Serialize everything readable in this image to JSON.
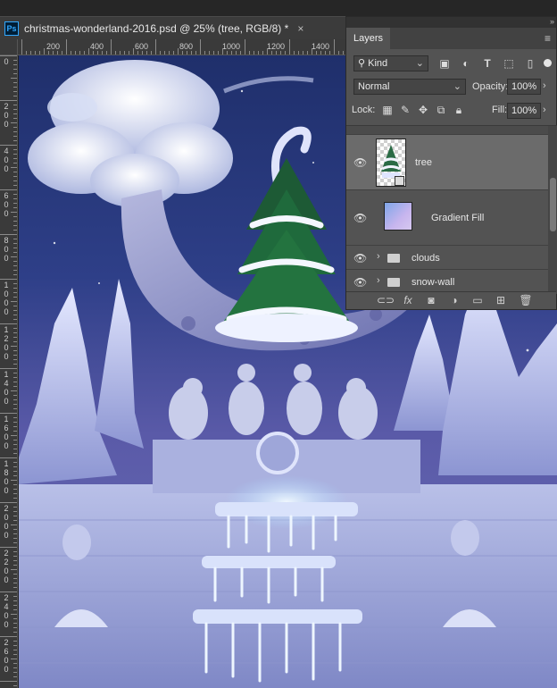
{
  "document": {
    "app_badge": "Ps",
    "tab_title": "christmas-wonderland-2016.psd @ 25% (tree, RGB/8) *",
    "close_glyph": "×"
  },
  "ruler": {
    "horizontal_labels": [
      "200",
      "400",
      "600",
      "800",
      "1000",
      "1200",
      "1400"
    ],
    "vertical_labels": [
      "0",
      "200",
      "400",
      "600",
      "800",
      "1000",
      "1200",
      "1400",
      "1600",
      "1800",
      "2000",
      "2200",
      "2400",
      "2600"
    ]
  },
  "layers_panel": {
    "tab_label": "Layers",
    "collapse_glyph": "»",
    "menu_glyph": "≡",
    "filter": {
      "value": "Kind",
      "icon": "search-icon"
    },
    "blend_mode": "Normal",
    "opacity_label": "Opacity:",
    "opacity_value": "100%",
    "lock_label": "Lock:",
    "fill_label": "Fill:",
    "fill_value": "100%",
    "layers": [
      {
        "name": "tree",
        "visible": true,
        "selected": true,
        "kind": "smart-object"
      },
      {
        "name": "Gradient Fill",
        "visible": true,
        "selected": false,
        "kind": "fill"
      },
      {
        "name": "clouds",
        "visible": true,
        "selected": false,
        "kind": "group"
      },
      {
        "name": "snow-wall",
        "visible": true,
        "selected": false,
        "kind": "group"
      }
    ],
    "footer_icons": [
      "link-icon",
      "fx-icon",
      "mask-icon",
      "adjustment-icon",
      "folder-icon",
      "new-layer-icon",
      "trash-icon"
    ]
  },
  "colors": {
    "panel_bg": "#535353",
    "selected_row": "#6b6b6b",
    "canvas_sky_top": "#1f2f6b",
    "canvas_sky_bottom": "#6c70b8",
    "ps_accent": "#31a8ff"
  }
}
